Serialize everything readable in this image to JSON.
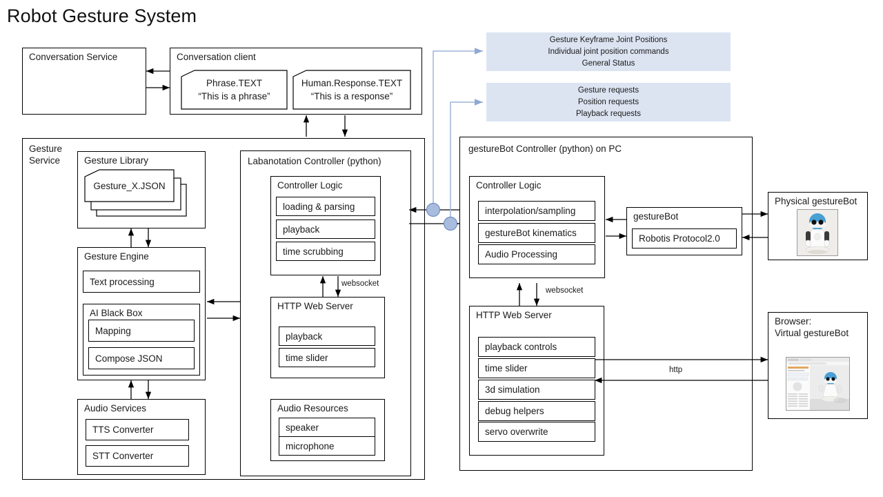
{
  "title": "Robot Gesture System",
  "conversation_service": {
    "label": "Conversation Service"
  },
  "conversation_client": {
    "label": "Conversation client",
    "notes": [
      {
        "name": "Phrase.TEXT",
        "value": "“This is a phrase”"
      },
      {
        "name": "Human.Response.TEXT",
        "value": "“This is a response”"
      }
    ]
  },
  "blue_panels": [
    {
      "lines": [
        "Gesture Keyframe Joint Positions",
        "Individual joint position commands",
        "General Status"
      ]
    },
    {
      "lines": [
        "Gesture requests",
        "Position requests",
        "Playback requests"
      ]
    }
  ],
  "gesture_service": {
    "label": "Gesture\nService",
    "gesture_library": {
      "label": "Gesture Library",
      "file": "Gesture_X.JSON"
    },
    "gesture_engine": {
      "label": "Gesture Engine",
      "text_processing": "Text processing",
      "ai_black_box": {
        "label": "AI Black Box",
        "items": [
          "Mapping",
          "Compose JSON"
        ]
      }
    },
    "audio_services": {
      "label": "Audio Services",
      "items": [
        "TTS Converter",
        "STT Converter"
      ]
    }
  },
  "labanotation_controller": {
    "label": "Labanotation Controller (python)",
    "controller_logic": {
      "label": "Controller Logic",
      "items": [
        "loading & parsing",
        "playback",
        "time scrubbing"
      ]
    },
    "http_web_server": {
      "label": "HTTP Web Server",
      "items": [
        "playback",
        "time slider"
      ]
    },
    "audio_resources": {
      "label": "Audio Resources",
      "items": [
        "speaker",
        "microphone"
      ]
    },
    "websocket_label": "websocket"
  },
  "gesturebot_controller": {
    "label": "gestureBot Controller (python) on PC",
    "controller_logic": {
      "label": "Controller Logic",
      "items": [
        "interpolation/sampling",
        "gestureBot kinematics",
        "Audio Processing"
      ]
    },
    "gesturebot": {
      "label": "gestureBot",
      "protocol": "Robotis Protocol2.0"
    },
    "http_web_server": {
      "label": "HTTP Web Server",
      "items": [
        "playback controls",
        "time slider",
        "3d simulation",
        "debug helpers",
        "servo overwrite"
      ]
    },
    "websocket_label": "websocket"
  },
  "physical_gesturebot": {
    "label": "Physical gestureBot"
  },
  "browser": {
    "label_line1": "Browser:",
    "label_line2": "Virtual gestureBot"
  },
  "edges": {
    "http_label": "http"
  },
  "colors": {
    "panel_blue": "#dce4f2",
    "connector_blue": "#9db3d8",
    "connector_fill": "#a8bcdd",
    "line_black": "#000000",
    "robot_head": "#4a9fd4"
  }
}
